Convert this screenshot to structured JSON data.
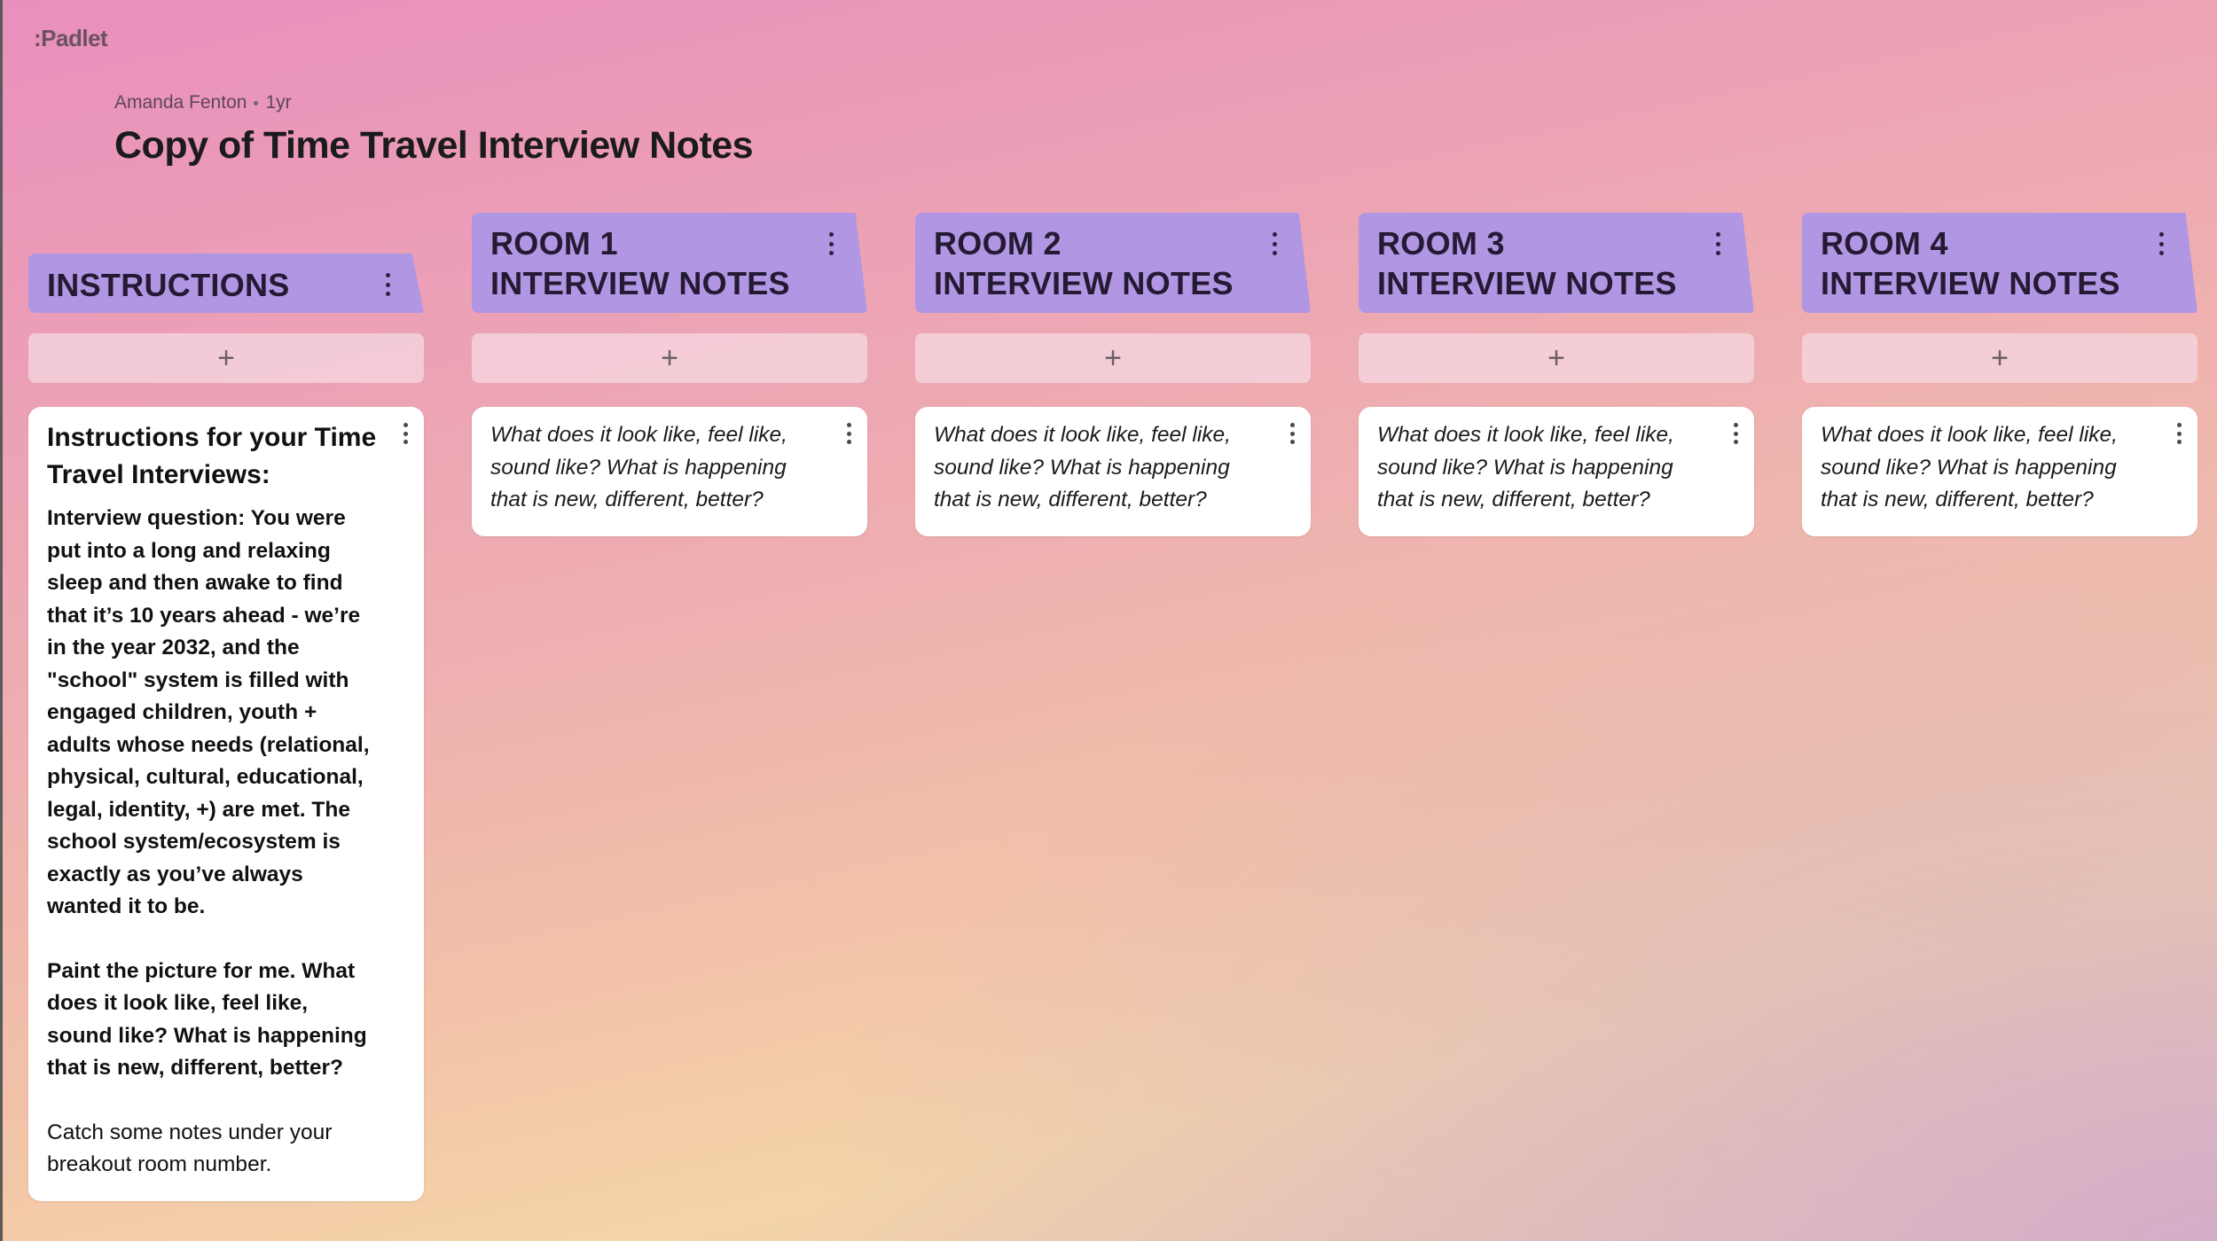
{
  "app": {
    "logo": ":Padlet"
  },
  "board": {
    "author": "Amanda Fenton",
    "age": "1yr",
    "title": "Copy of Time Travel Interview Notes"
  },
  "columns": [
    {
      "title": "INSTRUCTIONS",
      "add_label": "+",
      "card": {
        "heading": "Instructions for your Time Travel Interviews:",
        "para1": "Interview question: You were put into a long and relaxing sleep and then awake to find that it’s 10 years ahead - we’re in the year 2032, and the \"school\" system is filled with engaged children, youth + adults whose needs (relational, physical, cultural, educational, legal, identity, +) are met. The school system/ecosystem is exactly as you’ve always wanted it to be.",
        "para2": "Paint the picture for me. What does it look like, feel like, sound like? What is happening that is new, different, better?",
        "para3": "Catch some notes under your breakout room number."
      }
    },
    {
      "title": "ROOM 1 INTERVIEW NOTES",
      "add_label": "+",
      "card": {
        "text": "What does it look like, feel like, sound like? What is happening that is new, different, better?"
      }
    },
    {
      "title": "ROOM 2 INTERVIEW NOTES",
      "add_label": "+",
      "card": {
        "text": "What does it look like, feel like, sound like? What is happening that is new, different, better?"
      }
    },
    {
      "title": "ROOM 3 INTERVIEW NOTES",
      "add_label": "+",
      "card": {
        "text": "What does it look like, feel like, sound like? What is happening that is new, different, better?"
      }
    },
    {
      "title": "ROOM 4 INTERVIEW NOTES",
      "add_label": "+",
      "card": {
        "text": "What does it look like, feel like, sound like? What is happening that is new, different, better?"
      }
    }
  ],
  "colors": {
    "header_bg": "#b096e3",
    "card_bg": "#ffffff",
    "add_bg": "#f5d2dc"
  },
  "icons": {
    "column_menu": "more-vertical-icon",
    "card_menu": "more-vertical-icon",
    "add": "plus-icon"
  }
}
